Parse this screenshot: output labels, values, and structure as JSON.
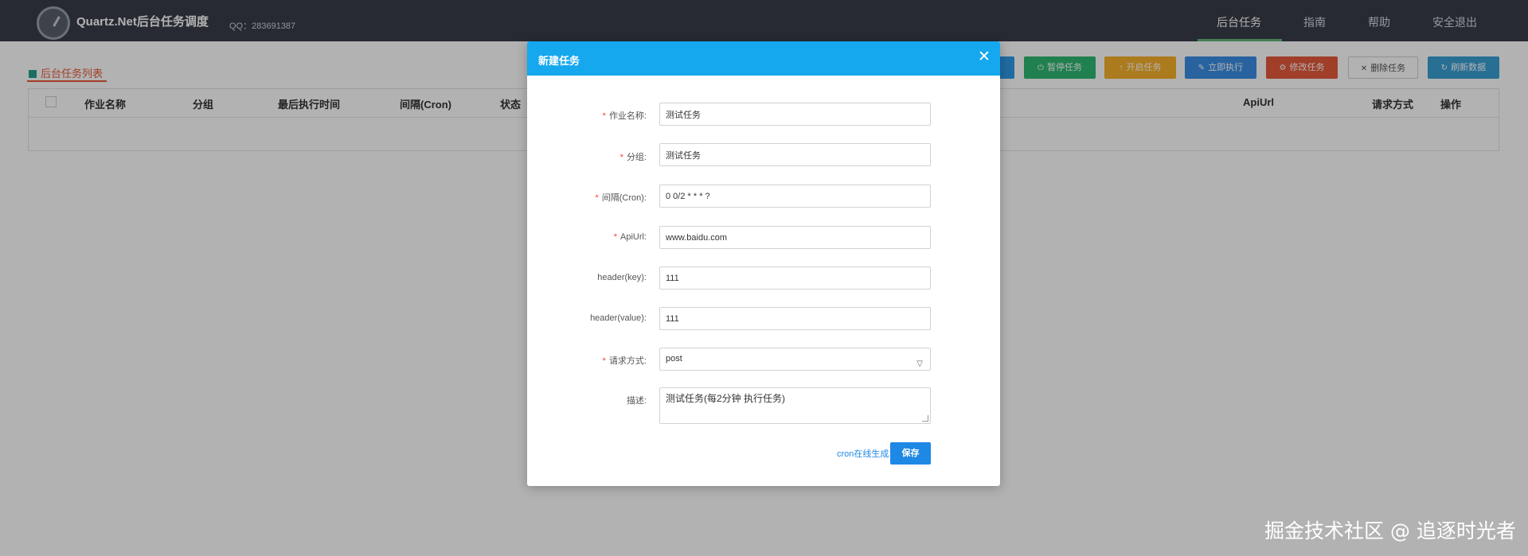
{
  "navbar": {
    "title": "Quartz.Net后台任务调度",
    "qq": "QQ：283691387",
    "items": [
      {
        "label": "后台任务",
        "active": true
      },
      {
        "label": "指南",
        "active": false
      },
      {
        "label": "帮助",
        "active": false
      },
      {
        "label": "安全退出",
        "active": false
      }
    ]
  },
  "page": {
    "section_title": "后台任务列表",
    "toolbar": [
      {
        "label": "暂停任务",
        "icon": "power-icon",
        "color": "#2eb872"
      },
      {
        "label": "开启任务",
        "icon": "play-icon",
        "color": "#f6b02b"
      },
      {
        "label": "立即执行",
        "icon": "edit-icon",
        "color": "#3a8ee6"
      },
      {
        "label": "修改任务",
        "icon": "gear-icon",
        "color": "#e55a3b"
      },
      {
        "label": "删除任务",
        "icon": "close-icon",
        "color": "#ffffff"
      },
      {
        "label": "刷新数据",
        "icon": "refresh-icon",
        "color": "#3a9fd5"
      }
    ],
    "table_headers": [
      "作业名称",
      "分组",
      "最后执行时间",
      "间隔(Cron)",
      "状态",
      "ApiUrl",
      "请求方式",
      "操作"
    ]
  },
  "modal": {
    "title": "新建任务",
    "fields": {
      "job_name": {
        "label": "作业名称:",
        "value": "测试任务",
        "required": true
      },
      "group": {
        "label": "分组:",
        "value": "测试任务",
        "required": true
      },
      "cron": {
        "label": "间隔(Cron):",
        "value": "0 0/2 * * * ?",
        "required": true
      },
      "api_url": {
        "label": "ApiUrl:",
        "value": "www.baidu.com",
        "required": true
      },
      "header_key": {
        "label": "header(key):",
        "value": "111",
        "required": false
      },
      "header_value": {
        "label": "header(value):",
        "value": "111",
        "required": false
      },
      "request_method": {
        "label": "请求方式:",
        "value": "post",
        "required": true
      },
      "description": {
        "label": "描述:",
        "value": "测试任务(每2分钟 执行任务)",
        "required": false
      }
    },
    "cron_link": "cron在线生成",
    "save_label": "保存"
  },
  "watermark": "掘金技术社区 @ 追逐时光者"
}
